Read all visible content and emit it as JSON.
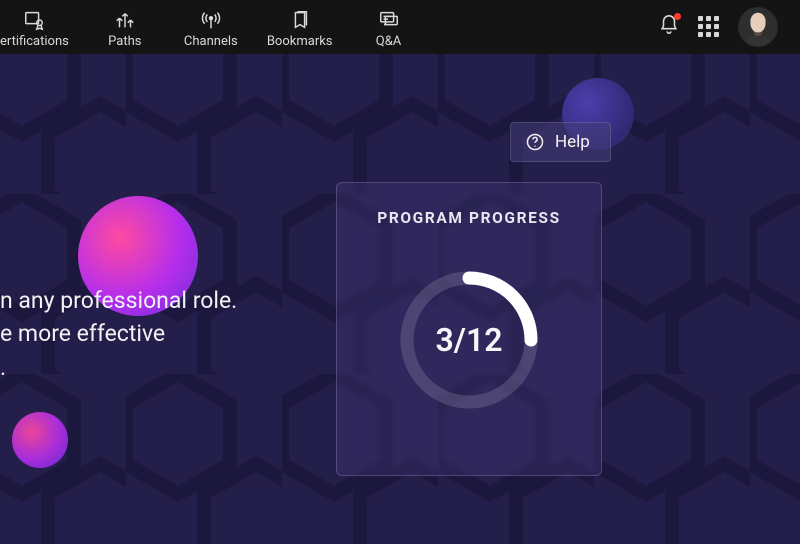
{
  "nav": {
    "tabs": [
      {
        "id": "certifications",
        "label": "ertifications",
        "icon": "certificate-icon"
      },
      {
        "id": "paths",
        "label": "Paths",
        "icon": "paths-icon"
      },
      {
        "id": "channels",
        "label": "Channels",
        "icon": "broadcast-icon"
      },
      {
        "id": "bookmarks",
        "label": "Bookmarks",
        "icon": "bookmark-icon"
      },
      {
        "id": "qa",
        "label": "Q&A",
        "icon": "qa-icon"
      }
    ]
  },
  "help": {
    "label": "Help"
  },
  "description": {
    "line1": "n any professional role.",
    "line2": "e more effective",
    "line3": "."
  },
  "progress": {
    "title": "PROGRAM PROGRESS",
    "completed": 3,
    "total": 12,
    "display": "3/12"
  },
  "notifications": {
    "has_unread": true
  },
  "colors": {
    "toolbar_bg": "#141414",
    "main_bg": "#241e4a",
    "accent_orb": "#b52eec",
    "notification_dot": "#ff3b30"
  }
}
